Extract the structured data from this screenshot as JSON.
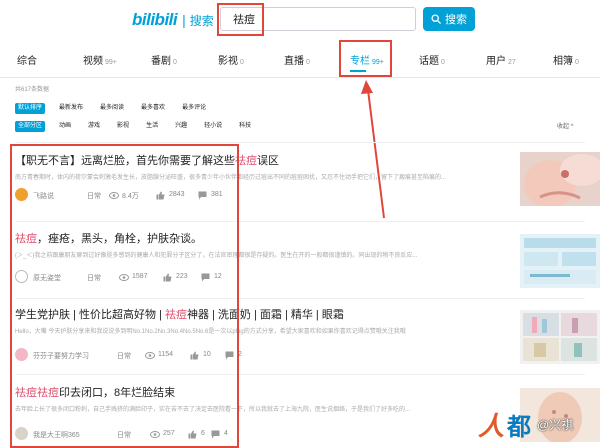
{
  "header": {
    "logo_text": "bilibili",
    "logo_suffix": "搜索",
    "search_value": "祛痘",
    "search_button": "搜索"
  },
  "tabs": [
    {
      "label": "综合",
      "count": ""
    },
    {
      "label": "视频",
      "count": "99+"
    },
    {
      "label": "番剧",
      "count": "0"
    },
    {
      "label": "影视",
      "count": "0"
    },
    {
      "label": "直播",
      "count": "0"
    },
    {
      "label": "专栏",
      "count": "99+"
    },
    {
      "label": "话题",
      "count": "0"
    },
    {
      "label": "用户",
      "count": "27"
    },
    {
      "label": "相簿",
      "count": "0"
    }
  ],
  "result_count": "共617条数据",
  "sort_filters": [
    "默认排序",
    "最新发布",
    "最多阅读",
    "最多喜欢",
    "最多评论"
  ],
  "zone_filters": [
    "全部分区",
    "动画",
    "游戏",
    "影视",
    "生活",
    "兴趣",
    "轻小说",
    "科技"
  ],
  "collapse_label": "收起 ^",
  "results": [
    {
      "title_pre": "【职无不言】远离烂脸，首先你需要了解这些",
      "title_hl": "祛痘",
      "title_post": "误区",
      "desc": "南方青春期时，体内的荷尔蒙会刺激毛发生长，皮脂腺分泌旺盛，很多青少年小伙伴都经历过痘出不同的痘痘困扰，又忍不住动手把它们，留下了瘢痕甚至陷痕的...",
      "author": "飞路说",
      "category": "日常",
      "views": "8.4万",
      "likes": "2843",
      "comments": "381"
    },
    {
      "title_pre": "",
      "title_hl": "祛痘",
      "title_post": "，痤疮，黑头，角栓，护肤杂谈。",
      "desc": "(＞_＜)我之前跟康朋友聊到过好像挺多感到的健康人和犯罪分子区分了，在法官审理都很是存疑的。医生在开的一般都很谨慎的。同出现的物不良反应...",
      "author": "原无姿堂",
      "category": "日常",
      "views": "1587",
      "likes": "223",
      "comments": "12"
    },
    {
      "title_pre": "学生党护肤 | 性价比超高好物 | ",
      "title_hl": "祛痘",
      "title_post": "神器 | 洗面奶 | 面霜 | 精华 | 眼霜",
      "desc": "Hello，大嘴 今天护肤分享来和我说说多到明No.1No.2No.3No.4No.5No.6是一次以plog的方式分享，希望大家喜欢和如果你喜欢记得点赞哦关注我哦",
      "author": "芬芬子要努力学习",
      "category": "日常",
      "views": "1154",
      "likes": "10",
      "comments": "2"
    },
    {
      "title_pre": "",
      "title_hl": "祛痘祛痘",
      "title_post": "印去闭口，8年烂脸结束",
      "desc": "去年脸上长了很多闭口粉刺，自己手贱挤的满脸印子，实在苦不去了决定去医院看一下，所以我就去了上海九院，医生说烟络，于是我们了好多吃的...",
      "author": "我是大王啊365",
      "category": "日常",
      "views": "257",
      "likes": "6",
      "comments": "4"
    }
  ],
  "watermark": {
    "brand": "人人都",
    "author": "@兴祺"
  },
  "colors": {
    "accent": "#00a1d6",
    "highlight": "#e04f6f",
    "annotation": "#e0463a"
  }
}
